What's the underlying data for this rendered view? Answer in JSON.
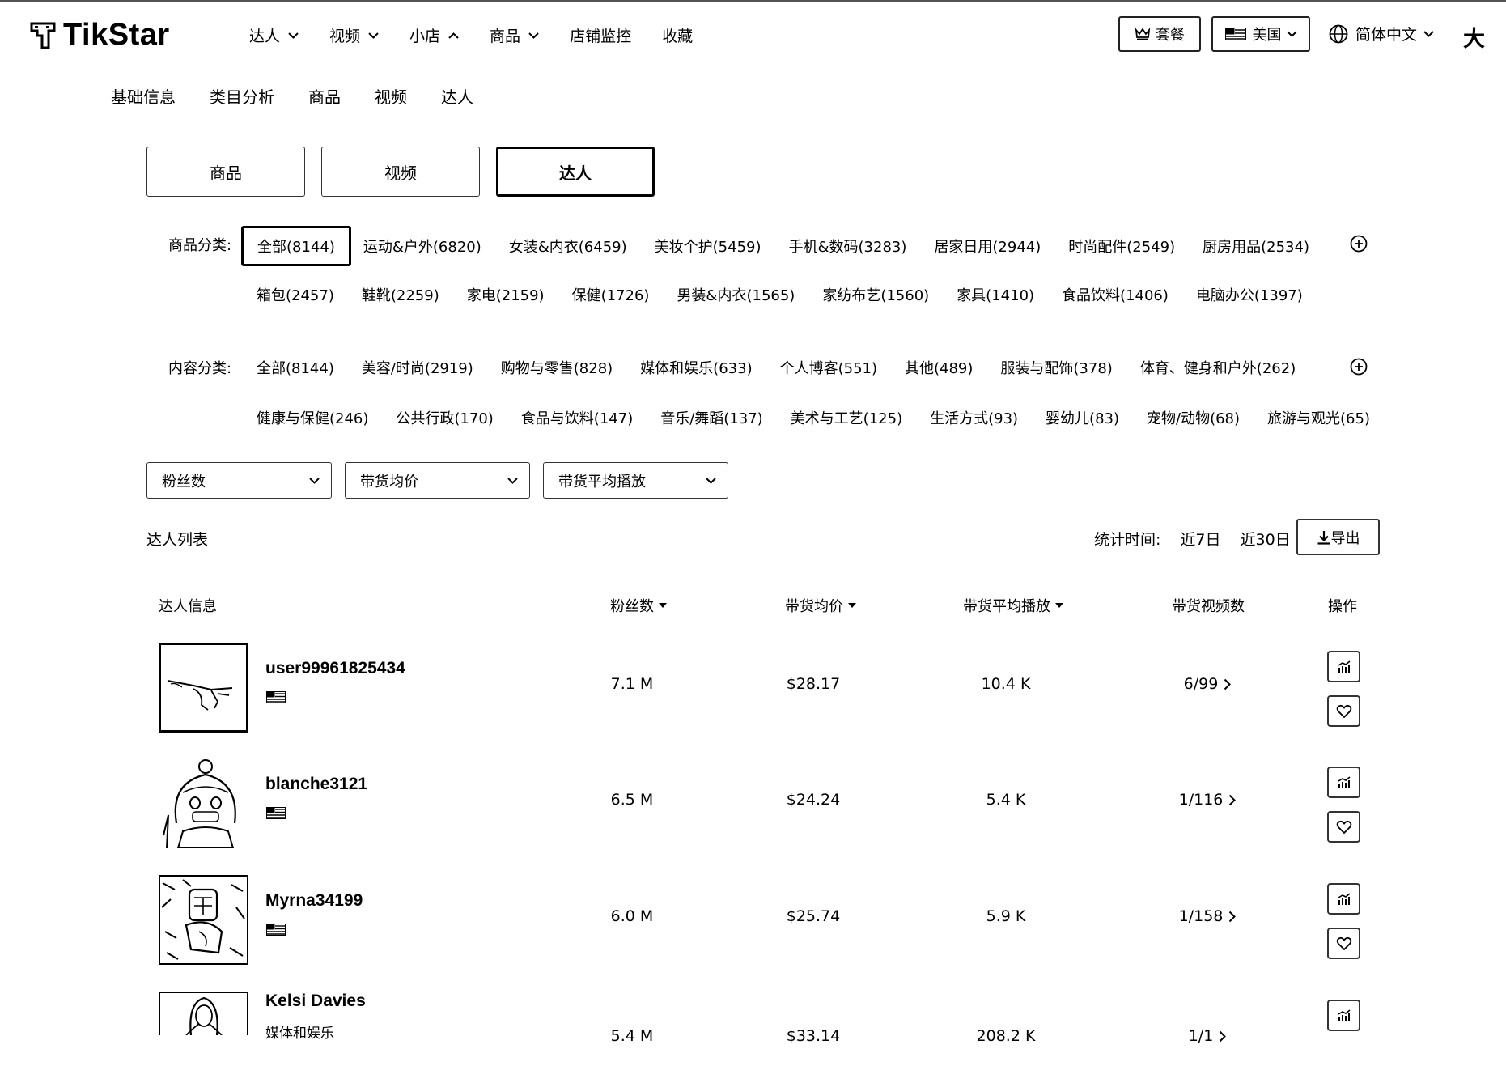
{
  "header": {
    "brand": "TikStar",
    "nav": [
      {
        "label": "达人",
        "chevron": "down"
      },
      {
        "label": "视频",
        "chevron": "down"
      },
      {
        "label": "小店",
        "chevron": "up"
      },
      {
        "label": "商品",
        "chevron": "down"
      },
      {
        "label": "店铺监控",
        "chevron": ""
      },
      {
        "label": "收藏",
        "chevron": ""
      }
    ],
    "plan_button": "套餐",
    "country_button": "美国",
    "language": "简体中文",
    "font_toggle": "大"
  },
  "subnav": [
    "基础信息",
    "类目分析",
    "商品",
    "视频",
    "达人"
  ],
  "tabs": [
    "商品",
    "视频",
    "达人"
  ],
  "active_tab_index": 2,
  "product_category": {
    "label": "商品分类:",
    "row1": [
      "全部(8144)",
      "运动&户外(6820)",
      "女装&内衣(6459)",
      "美妆个护(5459)",
      "手机&数码(3283)",
      "居家日用(2944)",
      "时尚配件(2549)",
      "厨房用品(2534)"
    ],
    "row2": [
      "箱包(2457)",
      "鞋靴(2259)",
      "家电(2159)",
      "保健(1726)",
      "男装&内衣(1565)",
      "家纺布艺(1560)",
      "家具(1410)",
      "食品饮料(1406)",
      "电脑办公(1397)"
    ],
    "selected": "全部(8144)"
  },
  "content_category": {
    "label": "内容分类:",
    "row1": [
      "全部(8144)",
      "美容/时尚(2919)",
      "购物与零售(828)",
      "媒体和娱乐(633)",
      "个人博客(551)",
      "其他(489)",
      "服装与配饰(378)",
      "体育、健身和户外(262)"
    ],
    "row2": [
      "健康与保健(246)",
      "公共行政(170)",
      "食品与饮料(147)",
      "音乐/舞蹈(137)",
      "美术与工艺(125)",
      "生活方式(93)",
      "婴幼儿(83)",
      "宠物/动物(68)",
      "旅游与观光(65)"
    ]
  },
  "dropdowns": [
    "粉丝数",
    "带货均价",
    "带货平均播放"
  ],
  "list": {
    "title": "达人列表",
    "stat_label": "统计时间:",
    "ranges": [
      "近7日",
      "近30日"
    ],
    "export": "导出"
  },
  "table": {
    "headers": [
      "达人信息",
      "粉丝数",
      "带货均价",
      "带货平均播放",
      "带货视频数",
      "操作"
    ],
    "rows": [
      {
        "name": "user99961825434",
        "sub": "",
        "followers": "7.1 M",
        "avg_price": "$28.17",
        "avg_views": "10.4 K",
        "videos": "6/99"
      },
      {
        "name": "blanche3121",
        "sub": "",
        "followers": "6.5 M",
        "avg_price": "$24.24",
        "avg_views": "5.4 K",
        "videos": "1/116"
      },
      {
        "name": "Myrna34199",
        "sub": "",
        "followers": "6.0 M",
        "avg_price": "$25.74",
        "avg_views": "5.9 K",
        "videos": "1/158"
      },
      {
        "name": "Kelsi Davies",
        "sub": "媒体和娱乐",
        "followers": "5.4 M",
        "avg_price": "$33.14",
        "avg_views": "208.2 K",
        "videos": "1/1"
      }
    ]
  }
}
